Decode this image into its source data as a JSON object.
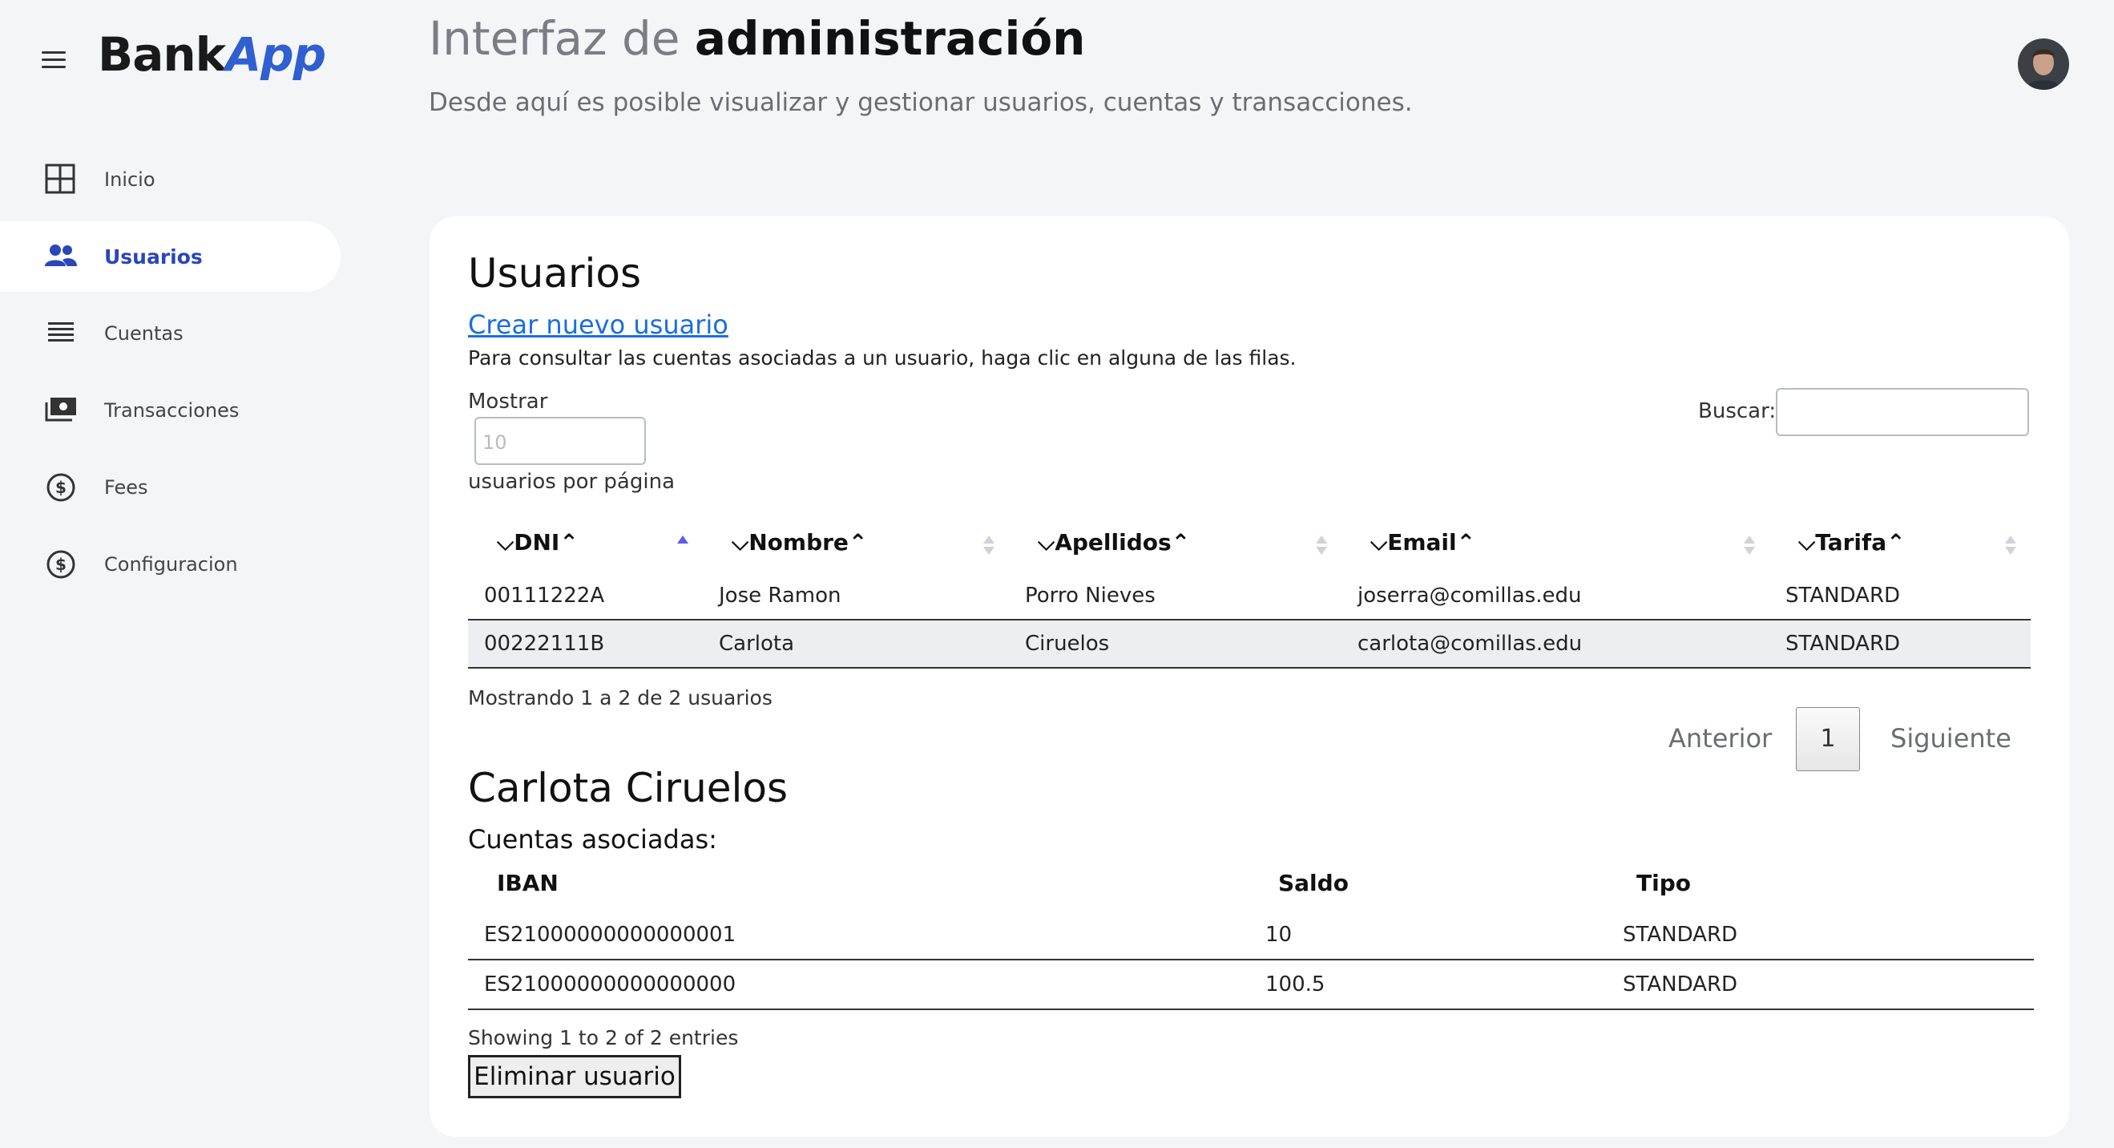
{
  "app": {
    "logo_part1": "Bank",
    "logo_part2": "App"
  },
  "header": {
    "title_light": "Interfaz de ",
    "title_bold": "administración",
    "subtitle": "Desde aquí es posible visualizar y gestionar usuarios, cuentas y transacciones."
  },
  "sidebar": {
    "items": [
      {
        "label": "Inicio",
        "icon": "grid-icon"
      },
      {
        "label": "Usuarios",
        "icon": "users-icon",
        "active": true
      },
      {
        "label": "Cuentas",
        "icon": "list-icon"
      },
      {
        "label": "Transacciones",
        "icon": "money-icon"
      },
      {
        "label": "Fees",
        "icon": "dollar-circle-icon"
      },
      {
        "label": "Configuracion",
        "icon": "dollar-circle-icon"
      }
    ]
  },
  "users_section": {
    "title": "Usuarios",
    "create_link": "Crear nuevo usuario",
    "hint": "Para consultar las cuentas asociadas a un usuario, haga clic en alguna de las filas.",
    "show_label": "Mostrar",
    "per_page_placeholder": "10",
    "per_page_suffix": "usuarios por página",
    "search_label": "Buscar:",
    "columns": [
      "⌵DNI⌃",
      "⌵Nombre⌃",
      "⌵Apellidos⌃",
      "⌵Email⌃",
      "⌵Tarifa⌃"
    ],
    "rows": [
      {
        "dni": "00111222A",
        "nombre": "Jose Ramon",
        "apellidos": "Porro Nieves",
        "email": "joserra@comillas.edu",
        "tarifa": "STANDARD"
      },
      {
        "dni": "00222111B",
        "nombre": "Carlota",
        "apellidos": "Ciruelos",
        "email": "carlota@comillas.edu",
        "tarifa": "STANDARD"
      }
    ],
    "info": "Mostrando 1 a 2 de 2 usuarios",
    "pager": {
      "prev": "Anterior",
      "page": "1",
      "next": "Siguiente"
    }
  },
  "selected_user": {
    "name": "Carlota Ciruelos",
    "accounts_label": "Cuentas asociadas:",
    "columns": [
      "IBAN",
      "Saldo",
      "Tipo"
    ],
    "rows": [
      {
        "iban": "ES21000000000000001",
        "saldo": "10",
        "tipo": "STANDARD"
      },
      {
        "iban": "ES21000000000000000",
        "saldo": "100.5",
        "tipo": "STANDARD"
      }
    ],
    "info": "Showing 1 to 2 of 2 entries",
    "delete_button": "Eliminar usuario"
  },
  "colors": {
    "accent": "#2a46b8",
    "link": "#1a6ee0",
    "background": "#f4f5f7"
  }
}
